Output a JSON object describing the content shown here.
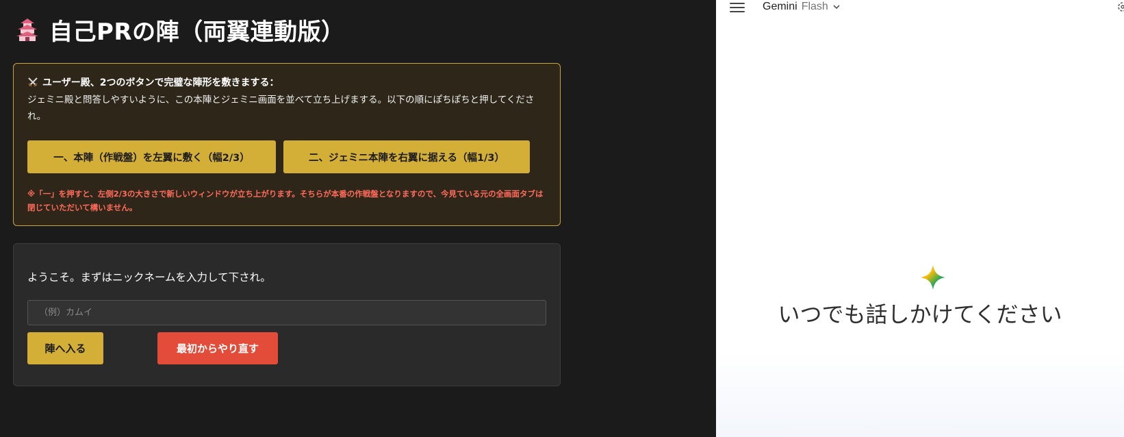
{
  "left": {
    "title": "自己PRの陣（両翼連動版）",
    "notice": {
      "heading": "ユーザー殿、2つのボタンで完璧な陣形を敷きまする：",
      "body": "ジェミニ殿と問答しやすいように、この本陣とジェミニ画面を並べて立ち上げまする。以下の順にぽちぽちと押してくだされ。",
      "button_left": "一、本陣（作戦盤）を左翼に敷く（幅2/3）",
      "button_right": "二、ジェミニ本陣を右翼に据える（幅1/3）",
      "warning": "※「一」を押すと、左側2/3の大きさで新しいウィンドウが立ち上がります。そちらが本番の作戦盤となりますので、今見ている元の全画面タブは閉じていただいて構いません。"
    },
    "welcome_card": {
      "message": "ようこそ。まずはニックネームを入力して下され。",
      "nickname_placeholder": "（例）カムイ",
      "nickname_value": "",
      "enter_button": "陣へ入る",
      "reset_button": "最初からやり直す"
    },
    "colors": {
      "accent": "#d4af37",
      "danger": "#e44c3a",
      "warning_text": "#ff6b5b"
    }
  },
  "right": {
    "model_name": "Gemini",
    "model_variant": "Flash",
    "greeting": "いつでも話しかけてください",
    "icons": [
      "menu-icon",
      "chevron-down-icon",
      "settings-icon",
      "gemini-spark-icon"
    ]
  }
}
